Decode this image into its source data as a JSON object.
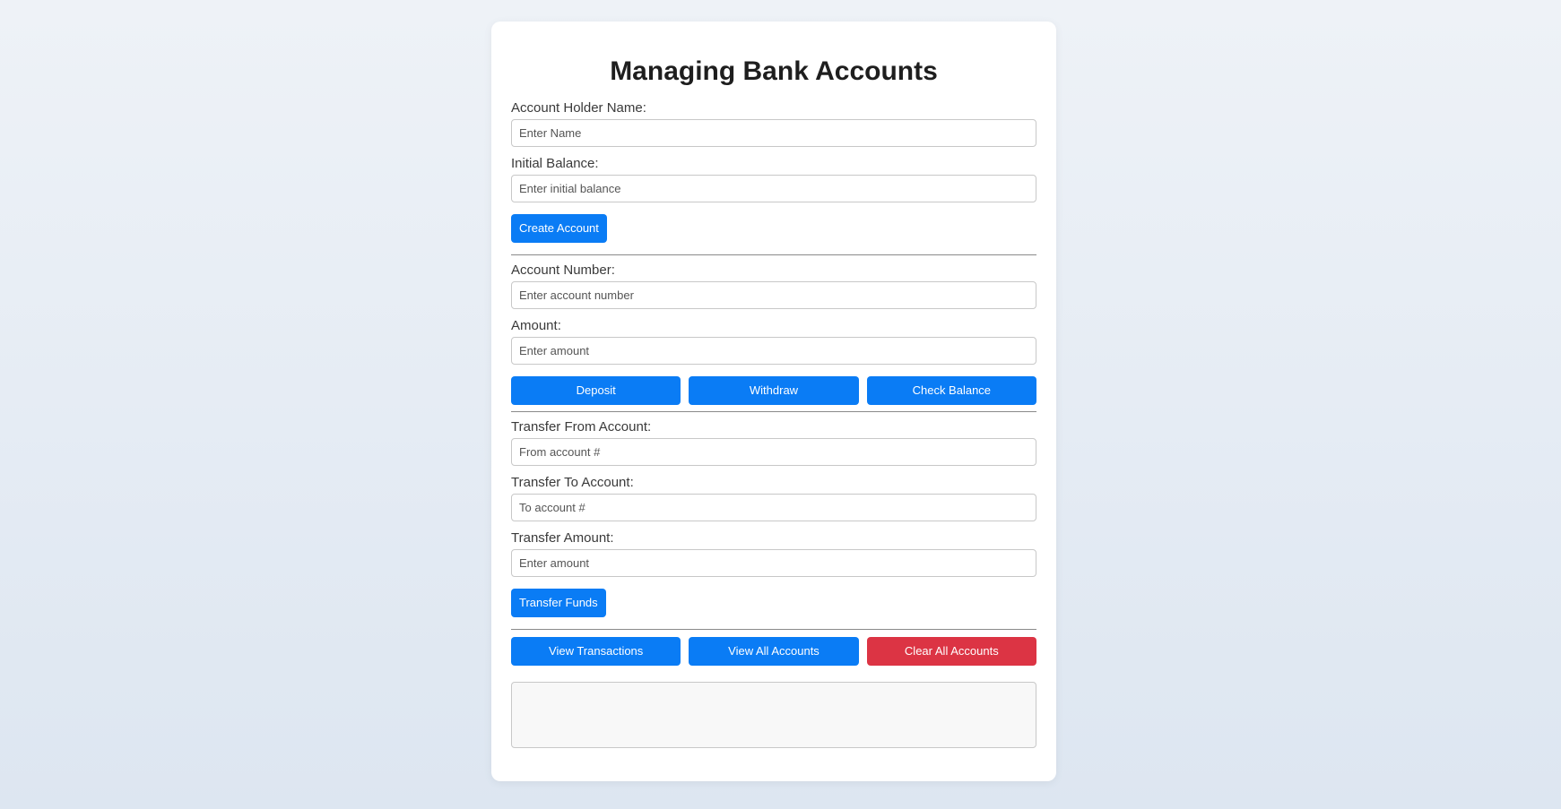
{
  "title": "Managing Bank Accounts",
  "create": {
    "name_label": "Account Holder Name:",
    "name_placeholder": "Enter Name",
    "balance_label": "Initial Balance:",
    "balance_placeholder": "Enter initial balance",
    "create_button": "Create Account"
  },
  "operations": {
    "account_label": "Account Number:",
    "account_placeholder": "Enter account number",
    "amount_label": "Amount:",
    "amount_placeholder": "Enter amount",
    "deposit_button": "Deposit",
    "withdraw_button": "Withdraw",
    "check_balance_button": "Check Balance"
  },
  "transfer": {
    "from_label": "Transfer From Account:",
    "from_placeholder": "From account #",
    "to_label": "Transfer To Account:",
    "to_placeholder": "To account #",
    "amount_label": "Transfer Amount:",
    "amount_placeholder": "Enter amount",
    "transfer_button": "Transfer Funds"
  },
  "actions": {
    "view_transactions_button": "View Transactions",
    "view_all_button": "View All Accounts",
    "clear_all_button": "Clear All Accounts"
  },
  "output": {
    "text": ""
  },
  "colors": {
    "primary": "#0a7cf5",
    "danger": "#dc3444"
  }
}
